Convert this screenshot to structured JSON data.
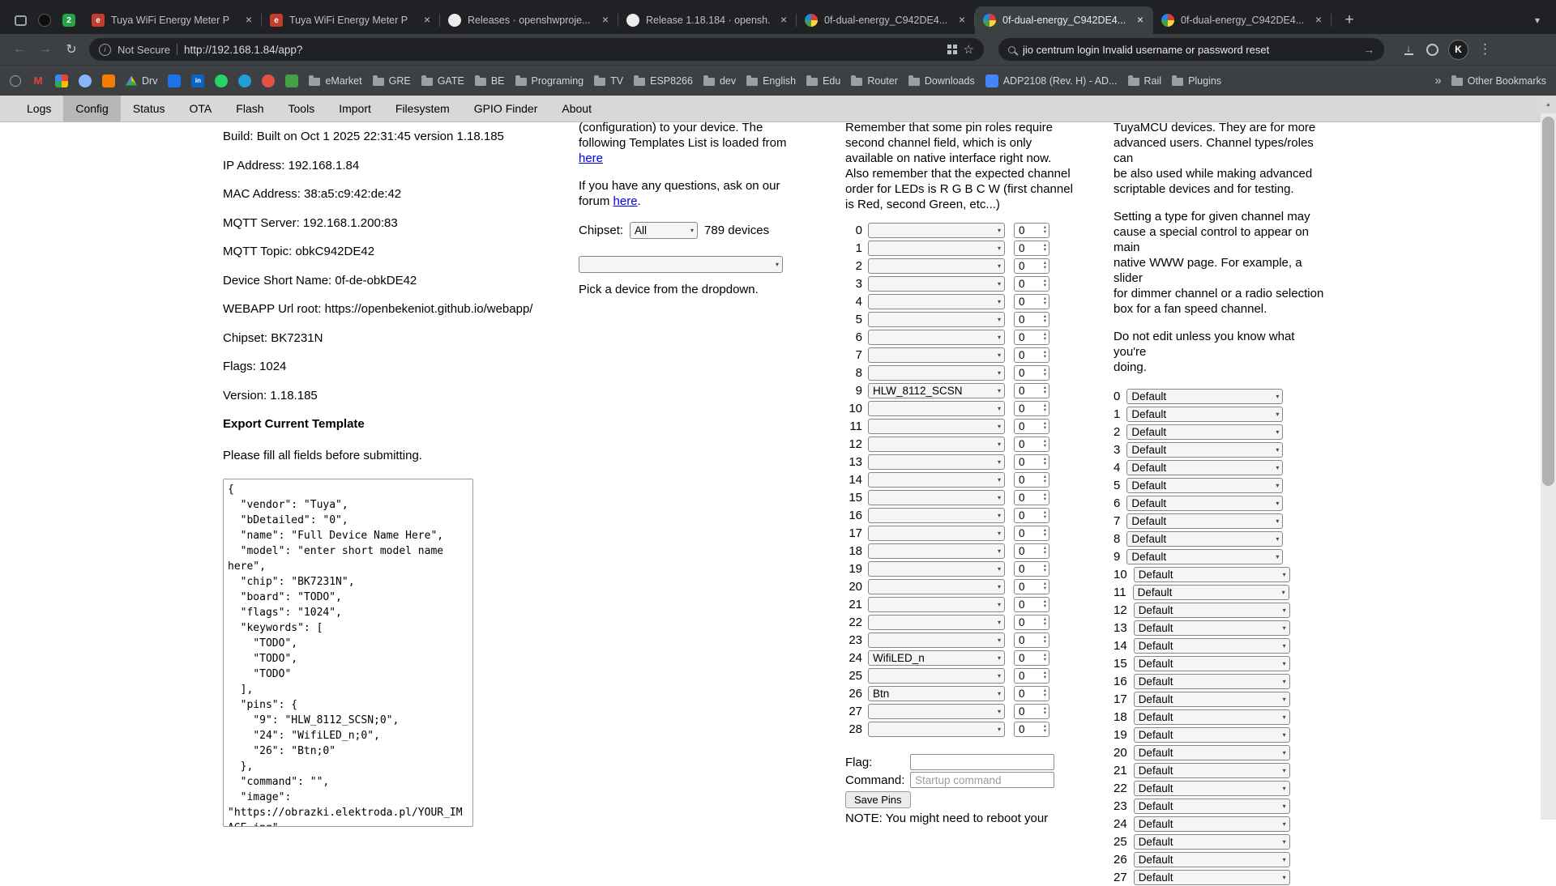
{
  "glyphs": {
    "close": "×",
    "plus": "+",
    "chevron_down": "▾",
    "tab_chevron": "▾",
    "back": "←",
    "forward": "→",
    "reload": "↻",
    "info": "i",
    "star": "☆",
    "search_arrow": "→",
    "download_arrow": "↓",
    "menu": "⋮",
    "spin_up": "▴",
    "spin_down": "▾",
    "overflow": "»",
    "scroll_up": "▲"
  },
  "browser": {
    "pinned_tabs": [
      {
        "icon": "window-icon",
        "style": "window",
        "label": ""
      },
      {
        "icon": "dark-app-icon",
        "style": "dark",
        "label": ""
      },
      {
        "icon": "badge-2-icon",
        "style": "green",
        "label": "2"
      }
    ],
    "tabs": [
      {
        "title": "Tuya WiFi Energy Meter P",
        "favicon": "elektroda",
        "active": false
      },
      {
        "title": "Tuya WiFi Energy Meter P",
        "favicon": "elektroda",
        "active": false
      },
      {
        "title": "Releases · openshwproje...",
        "favicon": "github",
        "active": false
      },
      {
        "title": "Release 1.18.184 · opensh...",
        "favicon": "github",
        "active": false
      },
      {
        "title": "0f-dual-energy_C942DE4...",
        "favicon": "openbeken",
        "active": false
      },
      {
        "title": "0f-dual-energy_C942DE4...",
        "favicon": "openbeken",
        "active": true
      },
      {
        "title": "0f-dual-energy_C942DE4...",
        "favicon": "openbeken",
        "active": false
      }
    ],
    "toolbar": {
      "security_label": "Not Secure",
      "url": "http://192.168.1.84/app?",
      "search_query": "jio centrum login Invalid username or password reset",
      "avatar_letter": "K"
    },
    "bookmarks": [
      {
        "type": "icon",
        "name": "globe-icon",
        "style": "ring2"
      },
      {
        "type": "icon",
        "name": "gmail-icon",
        "style": "letter",
        "glyph": "M",
        "color": "#ea4335"
      },
      {
        "type": "icon",
        "name": "multicolor-app-icon",
        "style": "quad"
      },
      {
        "type": "icon",
        "name": "contacts-icon",
        "style": "circle",
        "color": "#8ab4f8"
      },
      {
        "type": "icon",
        "name": "orange-app-icon",
        "style": "sq",
        "color": "#f57c00"
      },
      {
        "type": "drive",
        "name": "drive-bookmark",
        "label": "Drv"
      },
      {
        "type": "icon",
        "name": "blue-app-icon",
        "style": "sq",
        "color": "#1a73e8"
      },
      {
        "type": "icon",
        "name": "linkedin-icon",
        "style": "sqletter",
        "glyph": "in",
        "color": "#0a66c2"
      },
      {
        "type": "icon",
        "name": "whatsapp-icon",
        "style": "circle",
        "color": "#25d366"
      },
      {
        "type": "icon",
        "name": "telegram-icon",
        "style": "circle",
        "color": "#229ed9"
      },
      {
        "type": "icon",
        "name": "red-app-icon",
        "style": "circle",
        "color": "#e25241"
      },
      {
        "type": "icon",
        "name": "green-app-icon",
        "style": "sq",
        "color": "#43a047"
      },
      {
        "type": "folder",
        "label": "eMarket"
      },
      {
        "type": "folder",
        "label": "GRE"
      },
      {
        "type": "folder",
        "label": "GATE"
      },
      {
        "type": "folder",
        "label": "BE"
      },
      {
        "type": "folder",
        "label": "Programing"
      },
      {
        "type": "folder",
        "label": "TV"
      },
      {
        "type": "folder",
        "label": "ESP8266"
      },
      {
        "type": "folder",
        "label": "dev"
      },
      {
        "type": "folder",
        "label": "English"
      },
      {
        "type": "folder",
        "label": "Edu"
      },
      {
        "type": "folder",
        "label": "Router"
      },
      {
        "type": "folder",
        "label": "Downloads"
      },
      {
        "type": "page",
        "label": "ADP2108 (Rev. H) - AD...",
        "color": "#4285f4"
      },
      {
        "type": "folder",
        "label": "Rail"
      },
      {
        "type": "folder",
        "label": "Plugins"
      }
    ],
    "other_bookmarks_label": "Other Bookmarks"
  },
  "app": {
    "nav": {
      "tabs": [
        "Logs",
        "Config",
        "Status",
        "OTA",
        "Flash",
        "Tools",
        "Import",
        "Filesystem",
        "GPIO Finder",
        "About"
      ],
      "active": "Config"
    },
    "device_info": {
      "lines": [
        "Build: Built on Oct 1 2025 22:31:45 version 1.18.185",
        "IP Address: 192.168.1.84",
        "MAC Address: 38:a5:c9:42:de:42",
        "MQTT Server: 192.168.1.200:83",
        "MQTT Topic: obkC942DE42",
        "Device Short Name: 0f-de-obkDE42",
        "WEBAPP Url root: https://openbekeniot.github.io/webapp/",
        "Chipset: BK7231N",
        "Flags: 1024",
        "Version: 1.18.185"
      ]
    },
    "export_section": {
      "heading": "Export Current Template",
      "note": "Please fill all fields before submitting.",
      "template_json": "{\n  \"vendor\": \"Tuya\",\n  \"bDetailed\": \"0\",\n  \"name\": \"Full Device Name Here\",\n  \"model\": \"enter short model name here\",\n  \"chip\": \"BK7231N\",\n  \"board\": \"TODO\",\n  \"flags\": \"1024\",\n  \"keywords\": [\n    \"TODO\",\n    \"TODO\",\n    \"TODO\"\n  ],\n  \"pins\": {\n    \"9\": \"HLW_8112_SCSN;0\",\n    \"24\": \"WifiLED_n;0\",\n    \"26\": \"Btn;0\"\n  },\n  \"command\": \"\",\n  \"image\": \"https://obrazki.elektroda.pl/YOUR_IMAGE.jpg\",\n  \"wiki\": \"https://www.elektroda.com/"
    },
    "templates_panel": {
      "intro_text": "(configuration) to your device. The\nfollowing Templates List is loaded from\n",
      "intro_link": "here",
      "questions_text": "If you have any questions, ask on our\nforum ",
      "questions_link": "here",
      "questions_suffix": ".",
      "chipset_label": "Chipset:",
      "chipset_value": "All",
      "device_count": "789 devices",
      "pick_hint": "Pick a device from the dropdown."
    },
    "pins_panel": {
      "intro": "Remember that some pin roles require\nsecond channel field, which is only\navailable on native interface right now.\nAlso remember that the expected channel\norder for LEDs is R G B C W (first channel\nis Red, second Green, etc...)",
      "pin_count": 29,
      "pin_roles": {
        "9": "HLW_8112_SCSN",
        "24": "WifiLED_n",
        "26": "Btn"
      },
      "pin_channel_value": "0",
      "flag_label": "Flag:",
      "flag_value": "",
      "command_label": "Command:",
      "command_placeholder": "Startup command",
      "save_button": "Save Pins",
      "note": "NOTE: You might need to reboot your"
    },
    "channels_panel": {
      "intro1": "TuyaMCU devices. They are for more\nadvanced users. Channel types/roles can\nbe also used while making advanced\nscriptable devices and for testing.",
      "intro2": "Setting a type for given channel may\ncause a special control to appear on main\nnative WWW page. For example, a slider\nfor dimmer channel or a radio selection\nbox for a fan speed channel.",
      "intro3": "Do not edit unless you know what you're\ndoing.",
      "channel_count": 28,
      "channel_value": "Default"
    }
  }
}
